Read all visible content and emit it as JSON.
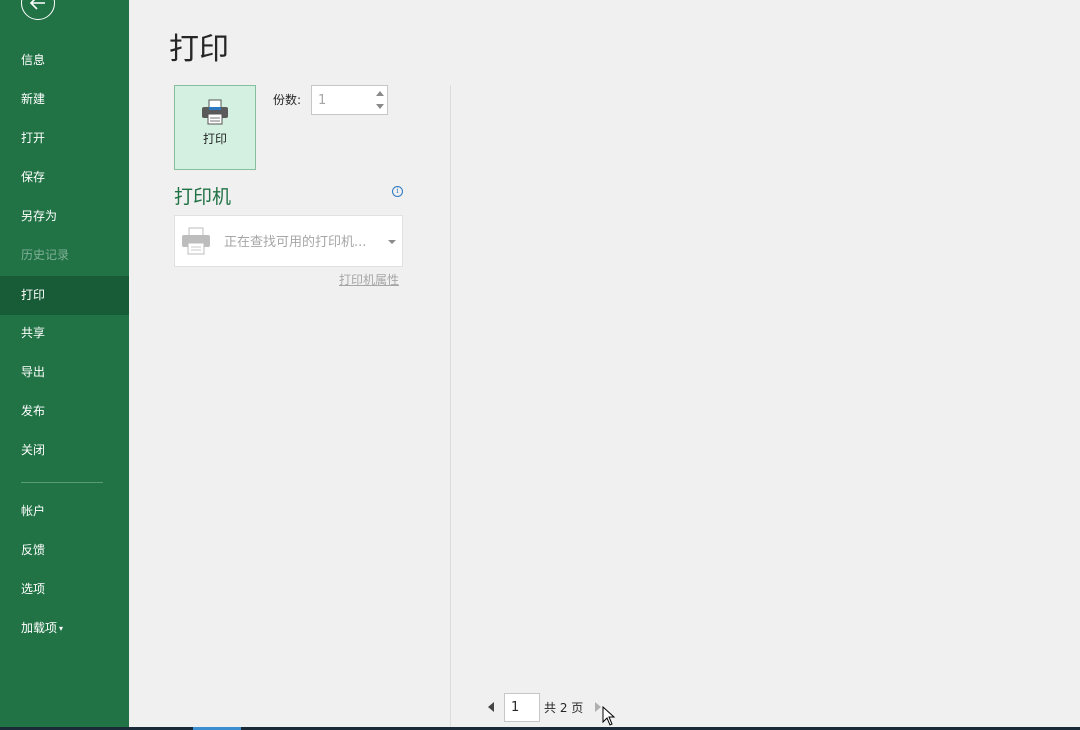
{
  "sidebar": {
    "back_icon": "back-arrow-icon",
    "items": [
      {
        "label": "信息"
      },
      {
        "label": "新建"
      },
      {
        "label": "打开"
      },
      {
        "label": "保存"
      },
      {
        "label": "另存为"
      },
      {
        "label": "历史记录",
        "state": "disabled"
      },
      {
        "label": "打印",
        "state": "active"
      },
      {
        "label": "共享"
      },
      {
        "label": "导出"
      },
      {
        "label": "发布"
      },
      {
        "label": "关闭"
      }
    ],
    "bottom_items": [
      {
        "label": "帐户"
      },
      {
        "label": "反馈"
      },
      {
        "label": "选项"
      },
      {
        "label": "加载项",
        "caret": "▾"
      }
    ]
  },
  "main": {
    "title": "打印",
    "print_button_label": "打印",
    "copies_label": "份数:",
    "copies_value": "1",
    "printer_heading": "打印机",
    "info_icon_glyph": "i",
    "printer_select_text": "正在查找可用的打印机...",
    "printer_properties_link": "打印机属性"
  },
  "pagination": {
    "current_page": "1",
    "total_label": "共 2 页"
  },
  "colors": {
    "sidebar_bg": "#217346",
    "sidebar_active": "#185c37",
    "accent_green": "#217346",
    "print_button_bg": "#d3f0e0"
  }
}
